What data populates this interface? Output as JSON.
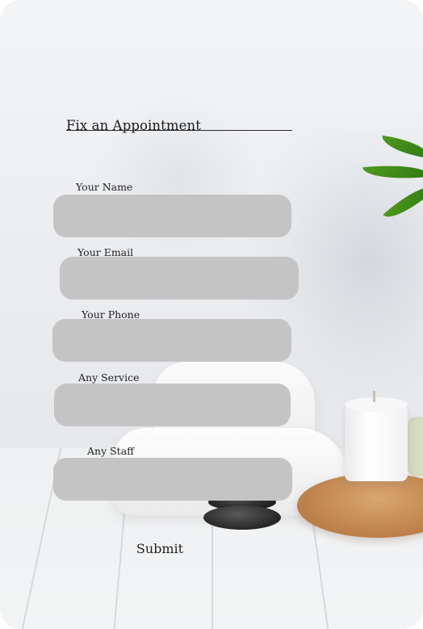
{
  "form": {
    "title": "Fix an Appointment",
    "fields": [
      {
        "label": "Your Name",
        "value": ""
      },
      {
        "label": "Your Email",
        "value": ""
      },
      {
        "label": "Your Phone",
        "value": ""
      },
      {
        "label": "Any Service",
        "value": ""
      },
      {
        "label": "Any Staff",
        "value": ""
      }
    ],
    "submit_label": "Submit"
  },
  "colors": {
    "field_fill": "#c4c4c4",
    "text": "#1f1f1f",
    "leaf_green": "#2f7a12",
    "board_wood": "#b97c45"
  }
}
